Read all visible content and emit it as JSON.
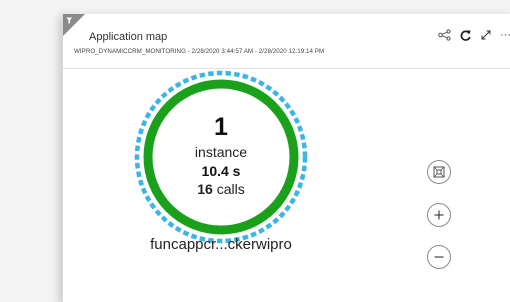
{
  "header": {
    "title": "Application map",
    "subtitle": "WIPRO_DYNAMICCRM_MONITORING - 2/28/2020 3:44:57 AM - 2/28/2020 12:19:14 PM"
  },
  "toolbar": {
    "icons": [
      "map-layout-icon",
      "refresh-icon",
      "expand-icon",
      "more-icon"
    ],
    "more_label": "···"
  },
  "node": {
    "instance_count": "1",
    "instance_label": "instance",
    "duration": "10.4 s",
    "calls_count": "16",
    "calls_label": " calls",
    "name": "funcappcr...ckerwipro",
    "ring_color": "#1aa01a",
    "outer_dash_color": "#3cb4e5"
  },
  "controls": {
    "icons": [
      "fit-to-screen-icon",
      "zoom-in-icon",
      "zoom-out-icon"
    ]
  }
}
